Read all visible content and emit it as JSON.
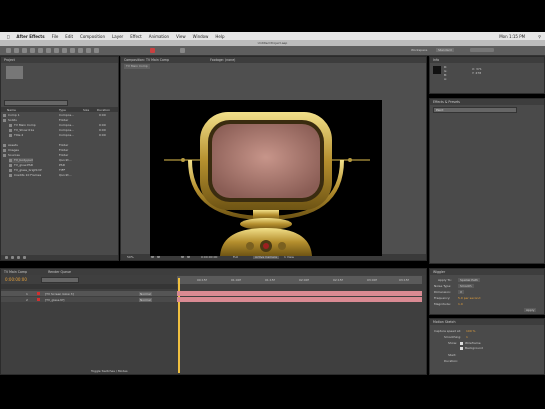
{
  "menu": {
    "app": "After Effects",
    "items": [
      "File",
      "Edit",
      "Composition",
      "Layer",
      "Effect",
      "Animation",
      "View",
      "Window",
      "Help"
    ],
    "clock": "Mon 1:15 PM"
  },
  "window_title": "Untitled Project.aep",
  "workspace": {
    "label1": "Workspace",
    "label2": "Standard"
  },
  "project_panel": {
    "tab": "Project",
    "columns": [
      "Name",
      "Type",
      "Size",
      "Duration"
    ],
    "rows": [
      {
        "name": "Comp 1",
        "type": "Compos...",
        "size": "",
        "dur": "0:00"
      },
      {
        "name": "Solids",
        "type": "Folder",
        "size": "",
        "dur": ""
      },
      {
        "name": "TV Main Comp",
        "type": "Compos...",
        "size": "",
        "dur": "0:00"
      },
      {
        "name": "TV_Show 01a",
        "type": "Compos...",
        "size": "",
        "dur": "0:00"
      },
      {
        "name": "Title 2",
        "type": "Compos...",
        "size": "",
        "dur": "0:00"
      },
      {
        "name": "Assets",
        "type": "Folder",
        "size": "",
        "dur": ""
      },
      {
        "name": "Images",
        "type": "Folder",
        "size": "",
        "dur": ""
      },
      {
        "name": "Sources",
        "type": "Folder",
        "size": "",
        "dur": ""
      },
      {
        "name": "TV_body.psd",
        "type": "Quickt...",
        "size": "",
        "dur": ""
      },
      {
        "name": "TV_glow.PSD",
        "type": "PSD",
        "size": "",
        "dur": ""
      },
      {
        "name": "TV_glass_bright.tif",
        "type": "TIFF",
        "size": "",
        "dur": ""
      },
      {
        "name": "Credits 10 Frames",
        "type": "Quickt...",
        "size": "",
        "dur": ""
      }
    ]
  },
  "viewer": {
    "tab": "Composition: TV Main Comp",
    "tab2": "Footage: (none)",
    "comp_button": "TV Main Comp",
    "zoom": "50%",
    "timecode": "0:00:00:00",
    "resolution": "Full",
    "camera": "Active Camera",
    "views": "1 View"
  },
  "timeline": {
    "tab": "TV Main Comp",
    "tab2": "Render Queue",
    "timecode": "0:00:00:00",
    "layers": [
      {
        "num": "1",
        "name": "[TV Screen Glow 3]",
        "mode": "Normal"
      },
      {
        "num": "2",
        "name": "[TV_glass.tif]",
        "mode": "Normal"
      }
    ],
    "ruler_labels": [
      "00:15f",
      "01:00f",
      "01:15f",
      "02:00f",
      "02:15f",
      "03:00f",
      "03:15f"
    ],
    "footer": "Toggle Switches / Modes"
  },
  "info_panel": {
    "tab": "Info",
    "r": "R:",
    "g": "G:",
    "b": "B:",
    "a": "A:",
    "x": "X: 371",
    "y": "Y: 478"
  },
  "effects_panel": {
    "tab": "Effects & Presets",
    "search": "Paint"
  },
  "wiggler_panel": {
    "tab": "Wiggler",
    "apply_to_label": "Apply To:",
    "apply_to_value": "Spatial Path",
    "noise_type_label": "Noise Type:",
    "noise_type_value": "Smooth",
    "dimension_label": "Dimension:",
    "dimension_value": "X",
    "frequency_label": "Frequency:",
    "frequency_value": "5.0 per second",
    "magnitude_label": "Magnitude:",
    "magnitude_value": "1.0",
    "apply_button": "Apply"
  },
  "motion_panel": {
    "tab": "Motion Sketch",
    "capture_speed_label": "Capture speed at:",
    "capture_speed_value": "100 %",
    "smoothing_label": "Smoothing:",
    "smoothing_value": "1",
    "show_label": "Show:",
    "wireframe": "Wireframe",
    "background": "Background",
    "start_label": "Start:",
    "duration_label": "Duration:"
  }
}
